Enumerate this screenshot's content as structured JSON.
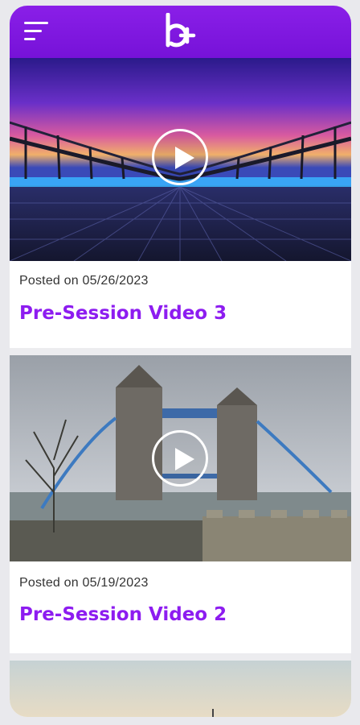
{
  "app": {
    "brand_color": "#8a1fe8",
    "menu_icon": "hamburger-menu-icon",
    "logo_icon": "b-plus-logo"
  },
  "posts": [
    {
      "date_text": "Posted on 05/26/2023",
      "title": "Pre-Session Video 3",
      "thumbnail": "millennium-bridge-night",
      "play_icon": "play-icon"
    },
    {
      "date_text": "Posted on 05/19/2023",
      "title": "Pre-Session Video 2",
      "thumbnail": "tower-bridge-london",
      "play_icon": "play-icon"
    },
    {
      "thumbnail": "sky-sunset"
    }
  ]
}
